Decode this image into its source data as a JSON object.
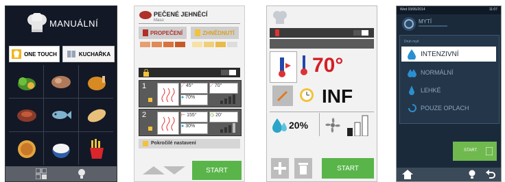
{
  "screen1": {
    "title": "MANUÁLNÍ",
    "tabs": [
      {
        "label": "ONE TOUCH",
        "icon": "chef-hat-icon"
      },
      {
        "label": "KUCHAŘKA",
        "icon": "book-icon"
      }
    ],
    "categories": [
      {
        "icon": "vegetables-icon"
      },
      {
        "icon": "meat-roll-icon"
      },
      {
        "icon": "chicken-icon"
      },
      {
        "icon": "steak-icon"
      },
      {
        "icon": "fish-icon"
      },
      {
        "icon": "bread-icon"
      },
      {
        "icon": "pie-icon"
      },
      {
        "icon": "rice-bowl-icon"
      },
      {
        "icon": "fries-icon"
      }
    ]
  },
  "screen2": {
    "recipe_title": "PEČENÉ JEHNĚCÍ",
    "subtitle": "Maso",
    "propeceni": "PROPEČENÍ",
    "zhnednuti": "ZHNĚDNUTÍ",
    "phase1": {
      "number": "1",
      "temp": "45°",
      "core": "70°",
      "humidity": "70%"
    },
    "phase2": {
      "number": "2",
      "temp": "155°",
      "time": "20'",
      "humidity": "30%"
    },
    "advanced": "Pokročilé nastavení",
    "start": "START"
  },
  "screen3": {
    "temp": "70°",
    "time": "INF",
    "humidity": "20%",
    "start": "START"
  },
  "screen4": {
    "status_left": "Wed 03/06/2014",
    "status_right": "11:07",
    "title": "MYTÍ",
    "section_label": "Druh mytí",
    "options": [
      "INTENZIVNÍ",
      "NORMÁLNÍ",
      "LEHKÉ",
      "POUZE OPLACH"
    ],
    "start": "START"
  }
}
